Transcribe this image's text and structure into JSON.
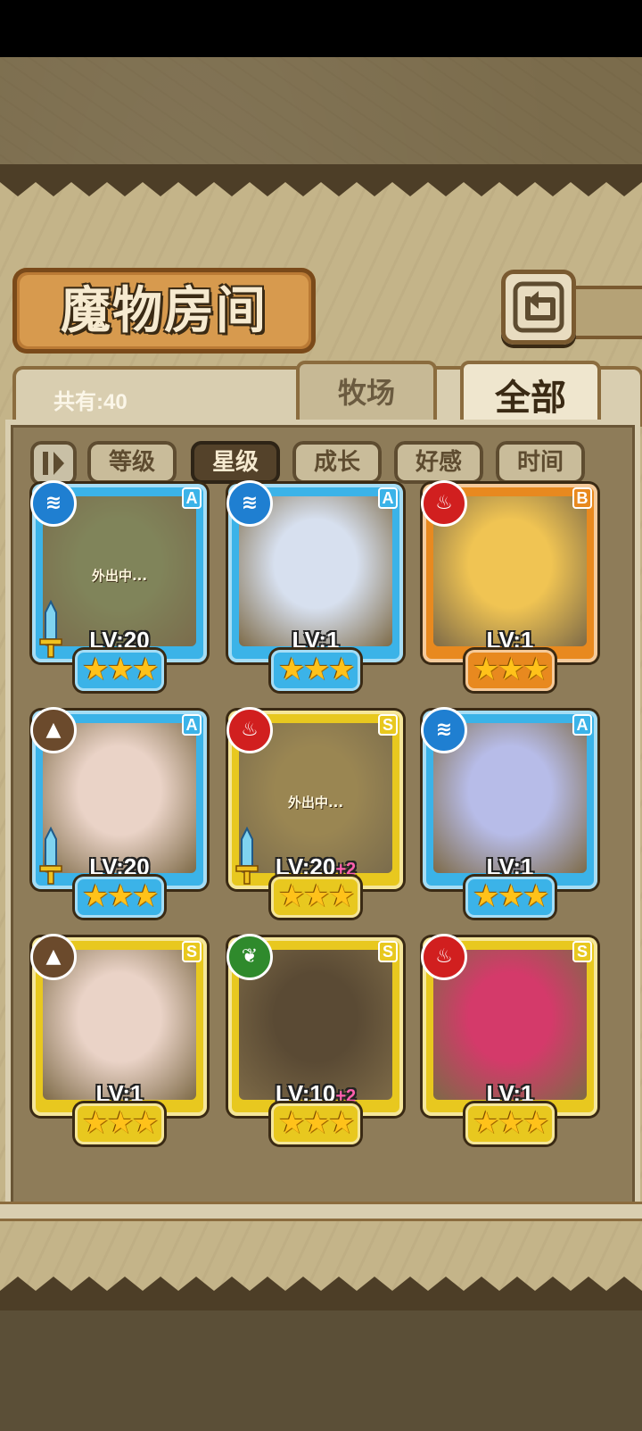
{
  "screen": {
    "title": "魔物房间"
  },
  "header": {
    "count_text": "共有:40",
    "tabs": [
      {
        "label": "牧场",
        "selected": false
      },
      {
        "label": "全部",
        "selected": true
      }
    ]
  },
  "sort": {
    "toggle_icon": "sort-order-icon",
    "options": [
      {
        "label": "等级",
        "selected": false
      },
      {
        "label": "星级",
        "selected": true
      },
      {
        "label": "成长",
        "selected": false
      },
      {
        "label": "好感",
        "selected": false
      },
      {
        "label": "时间",
        "selected": false
      }
    ]
  },
  "colors": {
    "frame_blue": "#3bb3e8",
    "frame_gold": "#e8c81f",
    "frame_orange": "#e8891f",
    "elem_water": "#1f7fd1",
    "elem_fire": "#d11f1f",
    "elem_earth": "#6b4a2c",
    "elem_wind": "#2f8a2c"
  },
  "cards": [
    {
      "lv": "LV:20",
      "plus": "",
      "rarity": "A",
      "frame": "blue",
      "element": "water-icon",
      "stars": 3,
      "status": "外出中...",
      "equipped": true,
      "tint": "#8aa067"
    },
    {
      "lv": "LV:1",
      "plus": "",
      "rarity": "A",
      "frame": "blue",
      "element": "water-icon",
      "stars": 3,
      "status": "",
      "equipped": false,
      "tint": "#d7e0ef"
    },
    {
      "lv": "LV:1",
      "plus": "",
      "rarity": "B",
      "frame": "orange",
      "element": "fire-icon",
      "stars": 3,
      "status": "",
      "equipped": false,
      "tint": "#f0c453"
    },
    {
      "lv": "LV:20",
      "plus": "",
      "rarity": "A",
      "frame": "blue",
      "element": "earth-icon",
      "stars": 3,
      "status": "",
      "equipped": true,
      "tint": "#ead3c7"
    },
    {
      "lv": "LV:20",
      "plus": "+2",
      "rarity": "S",
      "frame": "gold",
      "element": "fire-icon",
      "stars": 3,
      "status": "外出中...",
      "equipped": true,
      "tint": "#c3a456"
    },
    {
      "lv": "LV:1",
      "plus": "",
      "rarity": "A",
      "frame": "blue",
      "element": "water-icon",
      "stars": 3,
      "status": "",
      "equipped": false,
      "tint": "#b7bce8"
    },
    {
      "lv": "LV:1",
      "plus": "",
      "rarity": "S",
      "frame": "gold",
      "element": "earth-icon",
      "stars": 3,
      "status": "",
      "equipped": false,
      "tint": "#ead3c7"
    },
    {
      "lv": "LV:10",
      "plus": "+2",
      "rarity": "S",
      "frame": "gold",
      "element": "wind-icon",
      "stars": 3,
      "status": "",
      "equipped": false,
      "tint": "#5a4a34"
    },
    {
      "lv": "LV:1",
      "plus": "",
      "rarity": "S",
      "frame": "gold",
      "element": "fire-icon",
      "stars": 3,
      "status": "",
      "equipped": false,
      "tint": "#d43a6a"
    }
  ]
}
